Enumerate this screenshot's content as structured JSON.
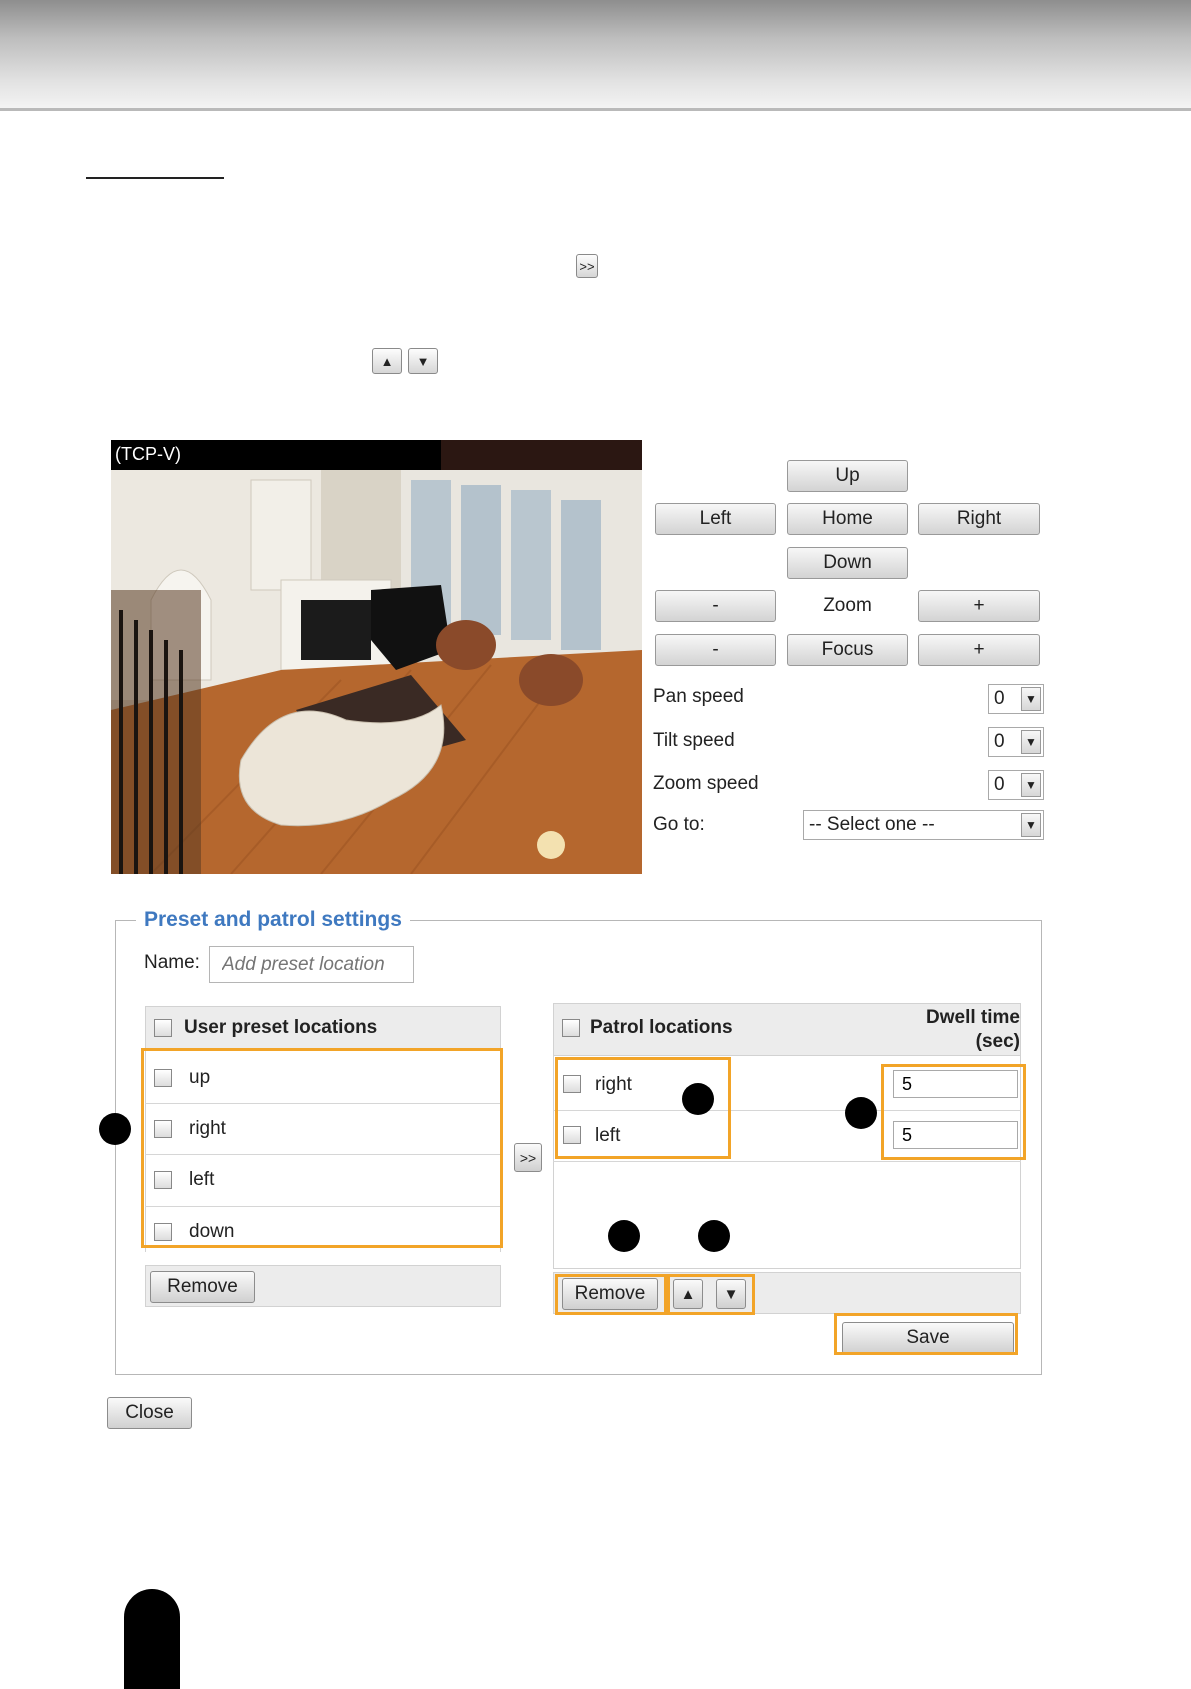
{
  "toolbar_samples": {
    "add_glyph": ">>",
    "up_glyph": "▲",
    "down_glyph": "▼"
  },
  "camera": {
    "stream_label": "(TCP-V)"
  },
  "ptz": {
    "up": "Up",
    "left": "Left",
    "home": "Home",
    "right": "Right",
    "down": "Down",
    "zoom_minus": "-",
    "zoom_label": "Zoom",
    "zoom_plus": "+",
    "focus_minus": "-",
    "focus_label": "Focus",
    "focus_plus": "+",
    "pan_speed_label": "Pan speed",
    "pan_speed_value": "0",
    "tilt_speed_label": "Tilt speed",
    "tilt_speed_value": "0",
    "zoom_speed_label": "Zoom speed",
    "zoom_speed_value": "0",
    "goto_label": "Go to:",
    "goto_value": "-- Select one --"
  },
  "preset": {
    "legend": "Preset and patrol settings",
    "name_label": "Name:",
    "name_placeholder": "Add preset location",
    "user_header": "User preset locations",
    "user_items": [
      "up",
      "right",
      "left",
      "down"
    ],
    "remove_label": "Remove",
    "add_glyph": ">>",
    "patrol_header": "Patrol locations",
    "dwell_header_line1": "Dwell time",
    "dwell_header_line2": "(sec)",
    "patrol_items": [
      {
        "label": "right",
        "dwell": "5"
      },
      {
        "label": "left",
        "dwell": "5"
      }
    ],
    "patrol_remove_label": "Remove",
    "move_up_glyph": "▲",
    "move_down_glyph": "▼",
    "save_label": "Save"
  },
  "close_label": "Close",
  "colors": {
    "highlight": "#f2a428",
    "legend_blue": "#3f79c0"
  }
}
